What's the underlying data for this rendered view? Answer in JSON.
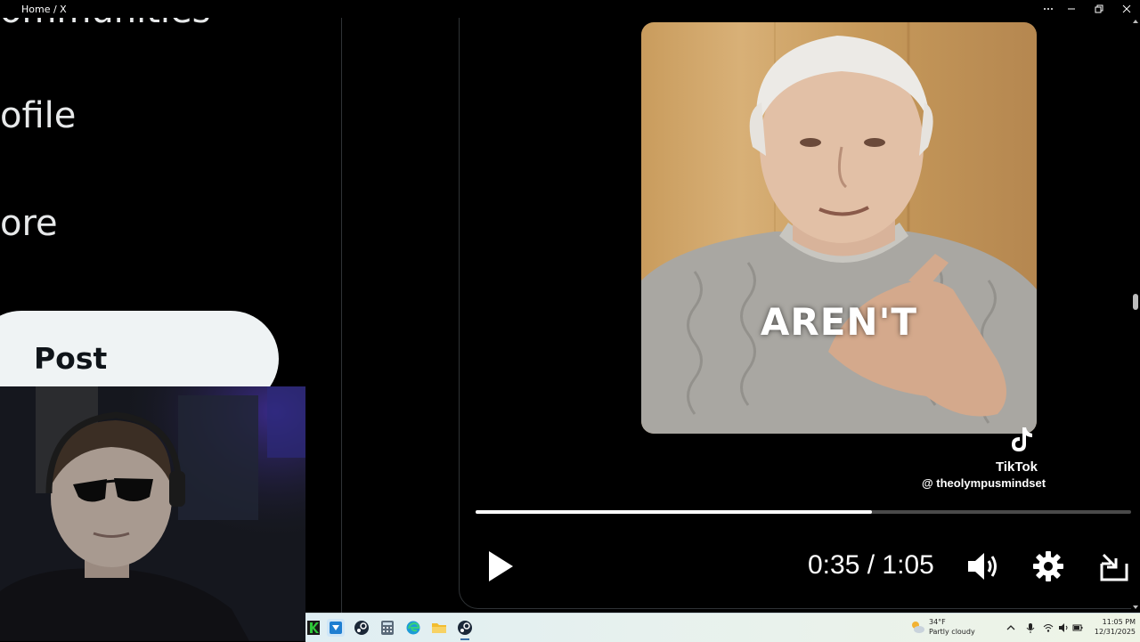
{
  "window": {
    "title": "Home / X"
  },
  "sidebar": {
    "items": [
      {
        "label": "ommunities"
      },
      {
        "label": "ofile"
      },
      {
        "label": "ore"
      }
    ],
    "post_button": "Post"
  },
  "video": {
    "caption": "AREN'T",
    "watermark_brand": "TikTok",
    "watermark_handle": "@ theolympusmindset",
    "time_display": "0:35 / 1:05",
    "progress": 0.605
  },
  "taskbar": {
    "weather_temp": "34°F",
    "weather_desc": "Partly cloudy",
    "clock_time": "11:05 PM",
    "clock_date": "12/31/2025"
  },
  "colors": {
    "background": "#000000",
    "post_button_bg": "#eff3f4",
    "text": "#e7e9ea"
  }
}
